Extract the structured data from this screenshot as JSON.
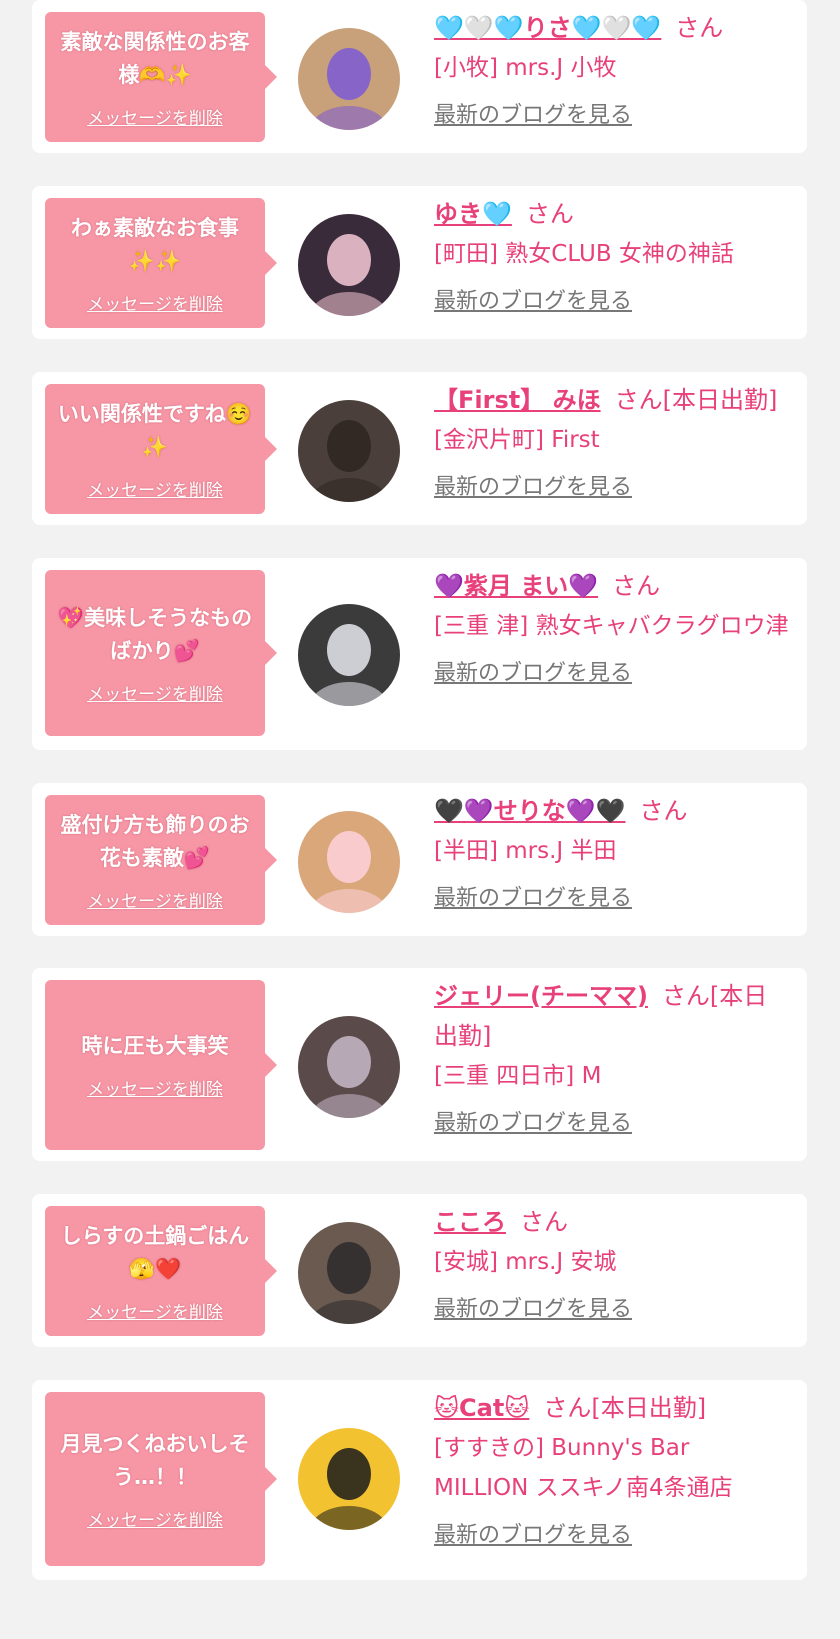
{
  "common": {
    "delete_label": "メッセージを削除",
    "blog_label": "最新のブログを見る",
    "san": "さん"
  },
  "colors": {
    "background": "#f2f2f2",
    "bubble": "#f797a6",
    "accent": "#e8407a",
    "link_gray": "#777777"
  },
  "cards": [
    {
      "message": "素敵な関係性のお客様🫶✨",
      "name": "🩵🤍🩵りさ🩵🤍🩵",
      "suffix": "さん",
      "shop": "[小牧] mrs.J 小牧",
      "avatar": {
        "icon": "avatar-photo-icon",
        "bg": "#c8a07a",
        "overlay": "#7b5ad6"
      }
    },
    {
      "message": "わぁ素敵なお食事✨✨",
      "name": "ゆき🩵",
      "suffix": "さん",
      "shop": "[町田] 熟女CLUB 女神の神話",
      "avatar": {
        "icon": "avatar-photo-icon",
        "bg": "#3a2b3a",
        "overlay": "#f7c9d6"
      }
    },
    {
      "message": "いい関係性ですね☺️✨",
      "name": "【First】 みほ",
      "suffix": "さん[本日出勤]",
      "shop": "[金沢片町] First",
      "avatar": {
        "icon": "avatar-photo-icon",
        "bg": "#4a3f3a",
        "overlay": "#2e2622"
      }
    },
    {
      "message": "💖美味しそうなものばかり💕",
      "name": "💜紫月 まい💜",
      "suffix": "さん",
      "shop": "[三重 津] 熟女キャバクラグロウ津",
      "avatar": {
        "icon": "avatar-photo-icon",
        "bg": "#3b3b3b",
        "overlay": "#e8e8f0"
      }
    },
    {
      "message": "盛付け方も飾りのお花も素敵💕",
      "name": "🖤💜せりな💜🖤",
      "suffix": "さん",
      "shop": "[半田] mrs.J 半田",
      "avatar": {
        "icon": "avatar-photo-icon",
        "bg": "#d9a77a",
        "overlay": "#ffd1dc"
      }
    },
    {
      "message": "時に圧も大事笑",
      "name": "ジェリー(チーママ)",
      "suffix": "さん[本日出勤]",
      "shop": "[三重 四日市] M",
      "avatar": {
        "icon": "avatar-photo-icon",
        "bg": "#5a4a4a",
        "overlay": "#c8b8c8"
      }
    },
    {
      "message": "しらすの土鍋ごはん🫣❤️",
      "name": "こころ",
      "suffix": "さん",
      "shop": "[安城] mrs.J 安城",
      "avatar": {
        "icon": "avatar-photo-icon",
        "bg": "#6b5a50",
        "overlay": "#2a2a2a"
      }
    },
    {
      "message": "月見つくねおいしそう…！！",
      "name": "🐱Cat🐱",
      "suffix": "さん[本日出勤]",
      "shop": "[すすきの] Bunny's Bar MILLION ススキノ南4条通店",
      "avatar": {
        "icon": "avatar-photo-icon",
        "bg": "#f2c230",
        "overlay": "#1a1a1a"
      }
    }
  ]
}
